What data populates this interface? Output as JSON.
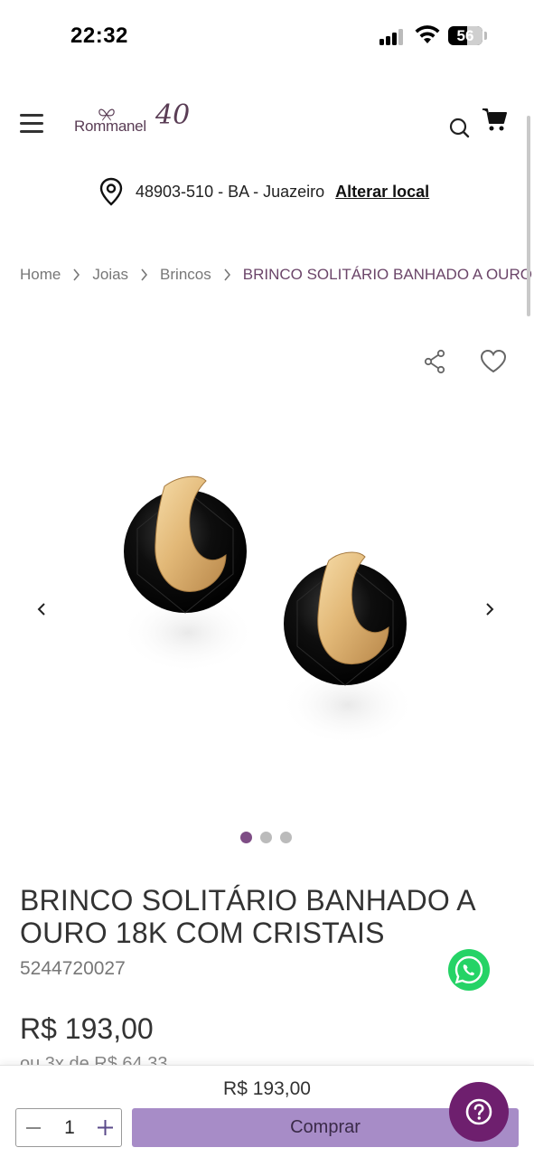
{
  "status_bar": {
    "time": "22:32",
    "battery_level": "56"
  },
  "header": {
    "logo_text": "Rommanel",
    "logo_anniversary": "40",
    "menu_icon": "hamburger-menu-icon",
    "search_icon": "search-icon",
    "cart_icon": "cart-icon"
  },
  "location": {
    "icon": "location-pin-icon",
    "text": "48903-510 - BA - Juazeiro",
    "link_label": "Alterar local"
  },
  "breadcrumb": {
    "items": [
      "Home",
      "Joias",
      "Brincos"
    ],
    "current": "BRINCO SOLITÁRIO BANHADO A OURO"
  },
  "product": {
    "title": "BRINCO SOLITÁRIO BANHADO A OURO 18K COM CRISTAIS",
    "sku": "5244720027",
    "price": "R$ 193,00",
    "installments": "ou 3x de R$ 64,33",
    "share_icon": "share-icon",
    "wishlist_icon": "heart-icon"
  },
  "gallery": {
    "image_count": 3,
    "active_index": 0
  },
  "purchase_bar": {
    "price": "R$ 193,00",
    "quantity": "1",
    "buy_label": "Comprar"
  },
  "colors": {
    "brand_purple": "#7e4d85",
    "buy_button": "#a78cc7",
    "help_button": "#6e1f6e",
    "whatsapp": "#25d366"
  }
}
